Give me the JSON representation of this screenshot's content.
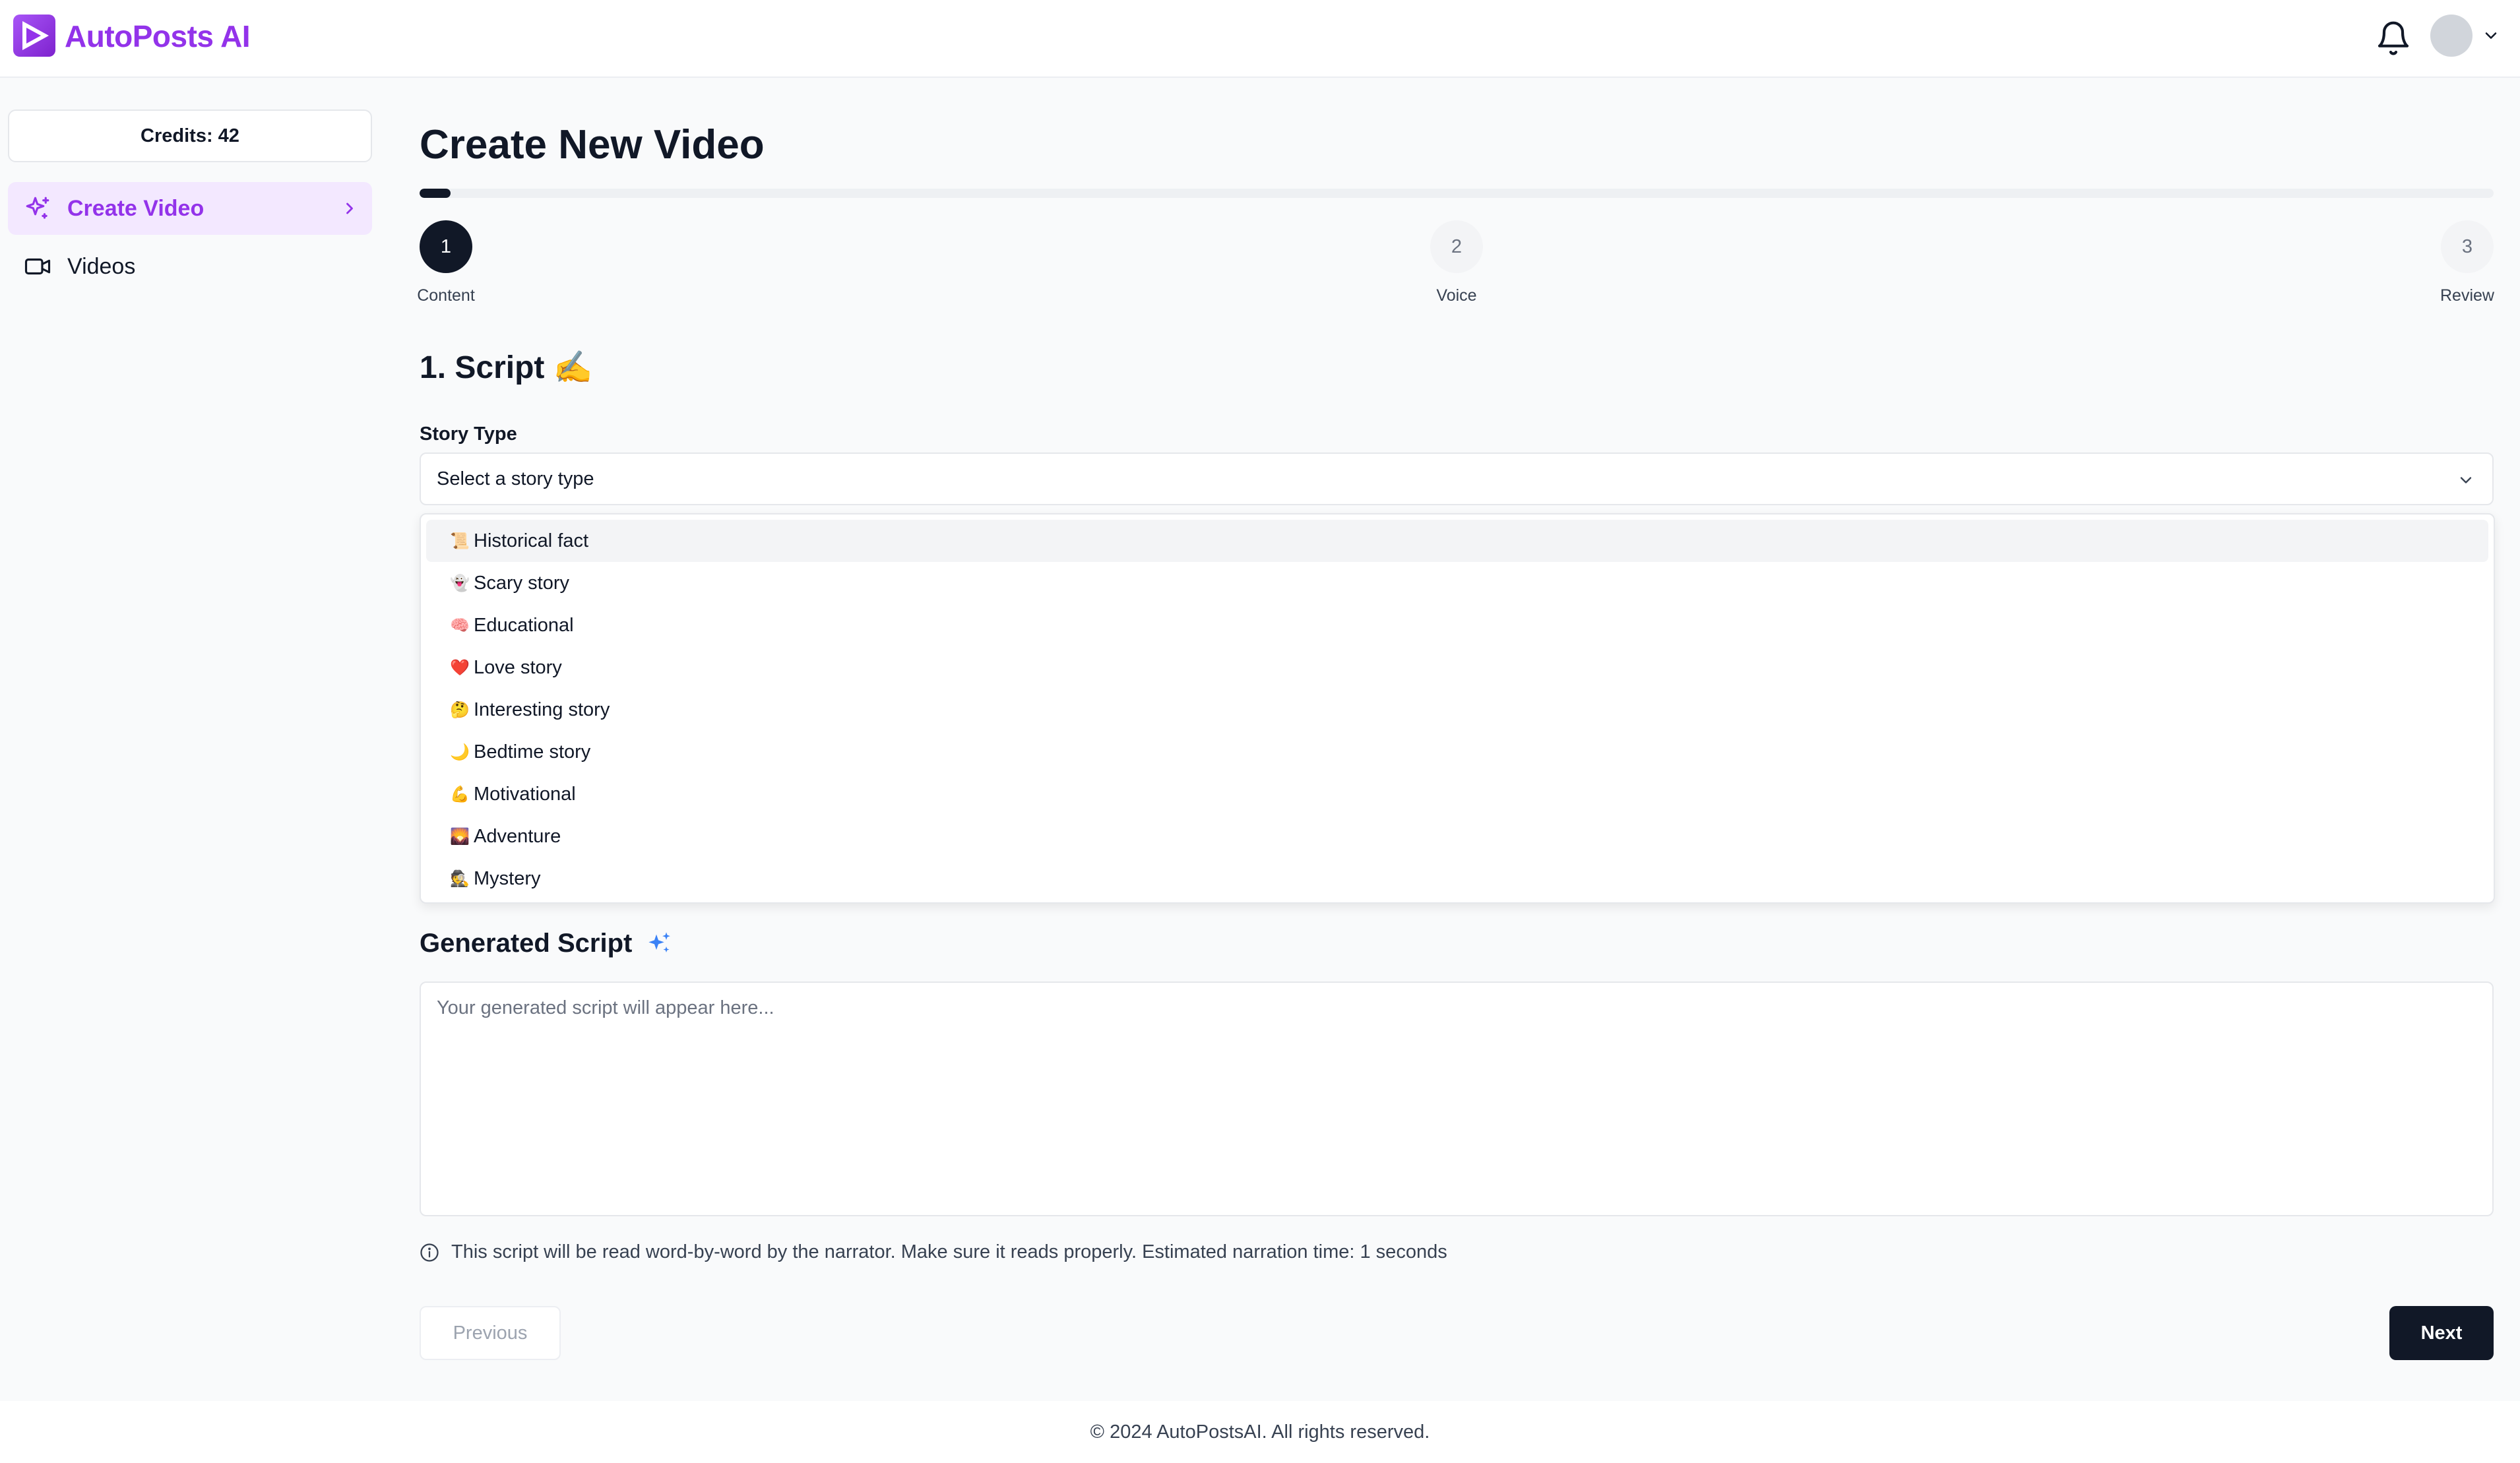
{
  "app": {
    "name": "AutoPosts AI",
    "brand_color": "#9333ea"
  },
  "header": {
    "icons": [
      "bell-icon",
      "avatar",
      "chevron-down-icon"
    ]
  },
  "sidebar": {
    "credits_label": "Credits: 42",
    "items": [
      {
        "label": "Create Video",
        "icon": "sparkles-icon",
        "active": true
      },
      {
        "label": "Videos",
        "icon": "video-camera-icon",
        "active": false
      }
    ]
  },
  "main": {
    "title": "Create New Video",
    "progress": 0.015,
    "steps": [
      {
        "number": "1",
        "label": "Content",
        "active": true
      },
      {
        "number": "2",
        "label": "Voice",
        "active": false
      },
      {
        "number": "3",
        "label": "Review",
        "active": false
      }
    ],
    "section_title": "1. Script ✍️",
    "story_type": {
      "label": "Story Type",
      "placeholder": "Select a story type",
      "options": [
        {
          "emoji": "📜",
          "label": "Historical fact"
        },
        {
          "emoji": "👻",
          "label": "Scary story"
        },
        {
          "emoji": "🧠",
          "label": "Educational"
        },
        {
          "emoji": "❤️",
          "label": "Love story"
        },
        {
          "emoji": "🤔",
          "label": "Interesting story"
        },
        {
          "emoji": "🌙",
          "label": "Bedtime story"
        },
        {
          "emoji": "💪",
          "label": "Motivational"
        },
        {
          "emoji": "🌄",
          "label": "Adventure"
        },
        {
          "emoji": "🕵️",
          "label": "Mystery"
        }
      ]
    },
    "generated_script": {
      "title": "Generated Script",
      "placeholder": "Your generated script will appear here...",
      "value": ""
    },
    "info_text": "This script will be read word-by-word by the narrator. Make sure it reads properly. Estimated narration time: 1 seconds",
    "buttons": {
      "previous": "Previous",
      "next": "Next"
    }
  },
  "footer": {
    "text": "© 2024 AutoPostsAI. All rights reserved."
  }
}
